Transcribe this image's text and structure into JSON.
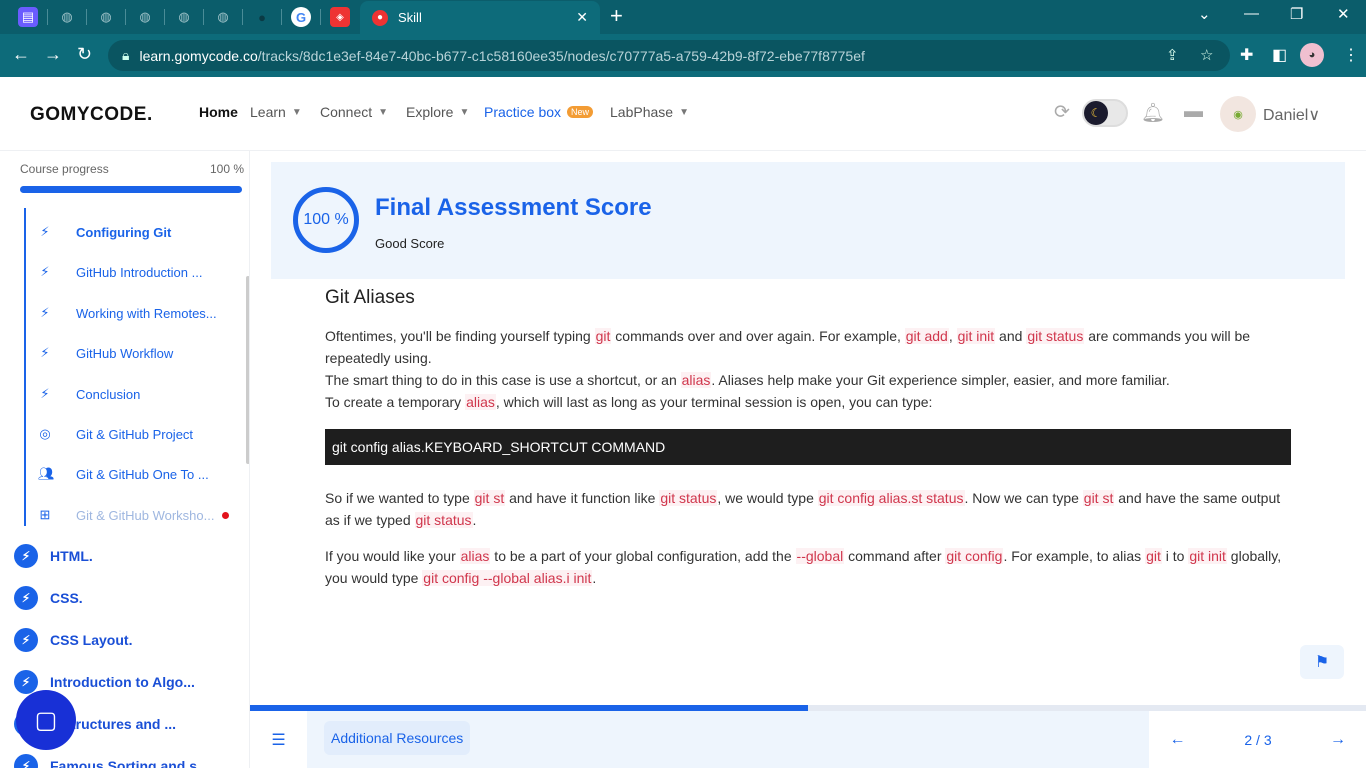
{
  "browser": {
    "tab_title": "Skill",
    "tab_close": "✕",
    "new_tab": "+",
    "url_host": "learn.gomycode.co",
    "url_path": "/tracks/8dc1e3ef-84e7-40bc-b677-c1c58160ee35/nodes/c70777a5-a759-42b9-8f72-ebe77f8775ef"
  },
  "header": {
    "logo": "GOMYCODE.",
    "nav": {
      "home": "Home",
      "learn": "Learn",
      "connect": "Connect",
      "explore": "Explore",
      "practice": "Practice box",
      "practice_badge": "New",
      "labphase": "LabPhase"
    },
    "user_name": "Daniel"
  },
  "sidebar": {
    "progress_label": "Course progress",
    "progress_value": "100 %",
    "progress_fraction": 1.0,
    "lessons": [
      {
        "label": "Configuring Git",
        "icon": "bolt-icon"
      },
      {
        "label": "GitHub Introduction ...",
        "icon": "bolt-icon"
      },
      {
        "label": "Working with Remotes...",
        "icon": "bolt-icon"
      },
      {
        "label": "GitHub Workflow",
        "icon": "bolt-icon"
      },
      {
        "label": "Conclusion",
        "icon": "bolt-icon"
      },
      {
        "label": "Git & GitHub Project",
        "icon": "target-icon"
      },
      {
        "label": "Git & GitHub One To ...",
        "icon": "people-icon"
      },
      {
        "label": "Git & GitHub Worksho...",
        "icon": "workshop-icon"
      }
    ],
    "modules": [
      {
        "label": "HTML."
      },
      {
        "label": "CSS."
      },
      {
        "label": "CSS Layout."
      },
      {
        "label": "Introduction to Algo..."
      },
      {
        "label": "a Structures and ..."
      },
      {
        "label": "Famous Sorting and s..."
      }
    ]
  },
  "score": {
    "percent": "100 %",
    "title": "Final Assessment Score",
    "subtitle": "Good Score"
  },
  "article": {
    "heading": "Git Aliases",
    "p1_a": "Oftentimes, you'll be finding yourself typing ",
    "p1_c1": "git",
    "p1_b": " commands over and over again. For example, ",
    "p1_c2": "git add",
    "p1_c": ", ",
    "p1_c3": "git init",
    "p1_d": " and ",
    "p1_c4": "git status",
    "p1_e": " are commands you will be repeatedly using.",
    "p2_a": "The smart thing to do in this case is use a shortcut, or an ",
    "p2_c1": "alias",
    "p2_b": ". Aliases help make your Git experience simpler, easier, and more familiar.",
    "p3_a": "To create a temporary ",
    "p3_c1": "alias",
    "p3_b": ", which will last as long as your terminal session is open, you can type:",
    "command": "git config alias.KEYBOARD_SHORTCUT COMMAND",
    "p4_a": "So if we wanted to type ",
    "p4_c1": "git st",
    "p4_b": " and have it function like ",
    "p4_c2": "git status",
    "p4_c": ", we would type ",
    "p4_c3": "git config alias.st status",
    "p4_d": ". Now we can type ",
    "p4_c4": "git st",
    "p4_e": " and have the same output as if we typed ",
    "p4_c5": "git status",
    "p4_f": ".",
    "p5_a": "If you would like your ",
    "p5_c1": "alias",
    "p5_b": " to be a part of your global configuration, add the ",
    "p5_c2": "--global",
    "p5_c": " command after ",
    "p5_c3": "git config",
    "p5_d": ". For example, to alias ",
    "p5_c4": "git",
    "p5_e": " i to ",
    "p5_c5": "git init",
    "p5_f": " globally, you would type ",
    "p5_c6": "git config --global alias.i init",
    "p5_g": "."
  },
  "footer": {
    "resources": "Additional Resources",
    "page": "2 / 3",
    "lesson_progress_fraction": 0.5
  },
  "colors": {
    "accent": "#1a63e8",
    "browser_chrome": "#0d6b7a",
    "code_text": "#d0364c"
  }
}
